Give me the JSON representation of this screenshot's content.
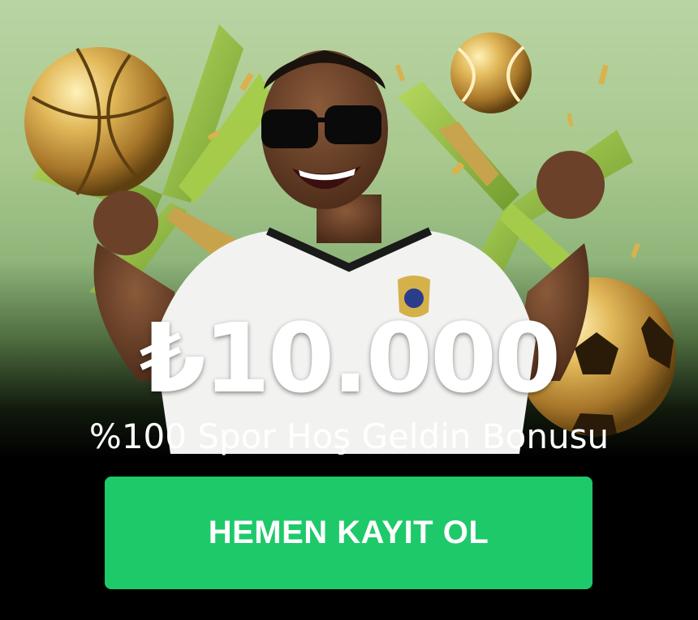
{
  "promo": {
    "amount": "₺10.000",
    "subtitle": "%100 Spor Hoş Geldin Bonusu",
    "cta_label": "HEMEN KAYIT OL"
  },
  "colors": {
    "cta_background": "#1ec96a",
    "accent_gold": "#c9a24a",
    "leaf_green": "#8cbf3f"
  },
  "icons": [
    "basketball-icon",
    "tennis-ball-icon",
    "soccer-ball-icon",
    "jersey-crest-icon"
  ]
}
